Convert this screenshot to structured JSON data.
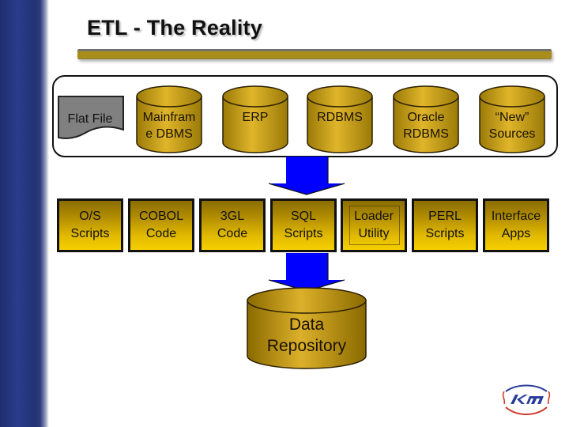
{
  "slide": {
    "title": "ETL - The Reality"
  },
  "sources": {
    "flat_file": "Flat File",
    "databases": [
      {
        "line1": "Mainfram",
        "line2": "e DBMS"
      },
      {
        "line1": "ERP",
        "line2": ""
      },
      {
        "line1": "RDBMS",
        "line2": ""
      },
      {
        "line1": "Oracle",
        "line2": "RDBMS"
      },
      {
        "line1": "“New”",
        "line2": "Sources"
      }
    ]
  },
  "tools": [
    {
      "line1": "O/S",
      "line2": "Scripts"
    },
    {
      "line1": "COBOL",
      "line2": "Code"
    },
    {
      "line1": "3GL",
      "line2": "Code"
    },
    {
      "line1": "SQL",
      "line2": "Scripts"
    },
    {
      "line1": "Loader",
      "line2": "Utility"
    },
    {
      "line1": "PERL",
      "line2": "Scripts"
    },
    {
      "line1": "Interface",
      "line2": "Apps"
    }
  ],
  "target": {
    "line1": "Data",
    "line2": "Repository"
  },
  "colors": {
    "arrow": "#0000ff",
    "cylinder": "#c9a214",
    "tool_box_top": "#8a6d00",
    "tool_box_bottom": "#f6d000",
    "flat_file": "#808080",
    "sidebar": "#2a3c8c",
    "title_rule": "#a98d1c"
  },
  "logo": {
    "icon": "company-logo-icon"
  }
}
